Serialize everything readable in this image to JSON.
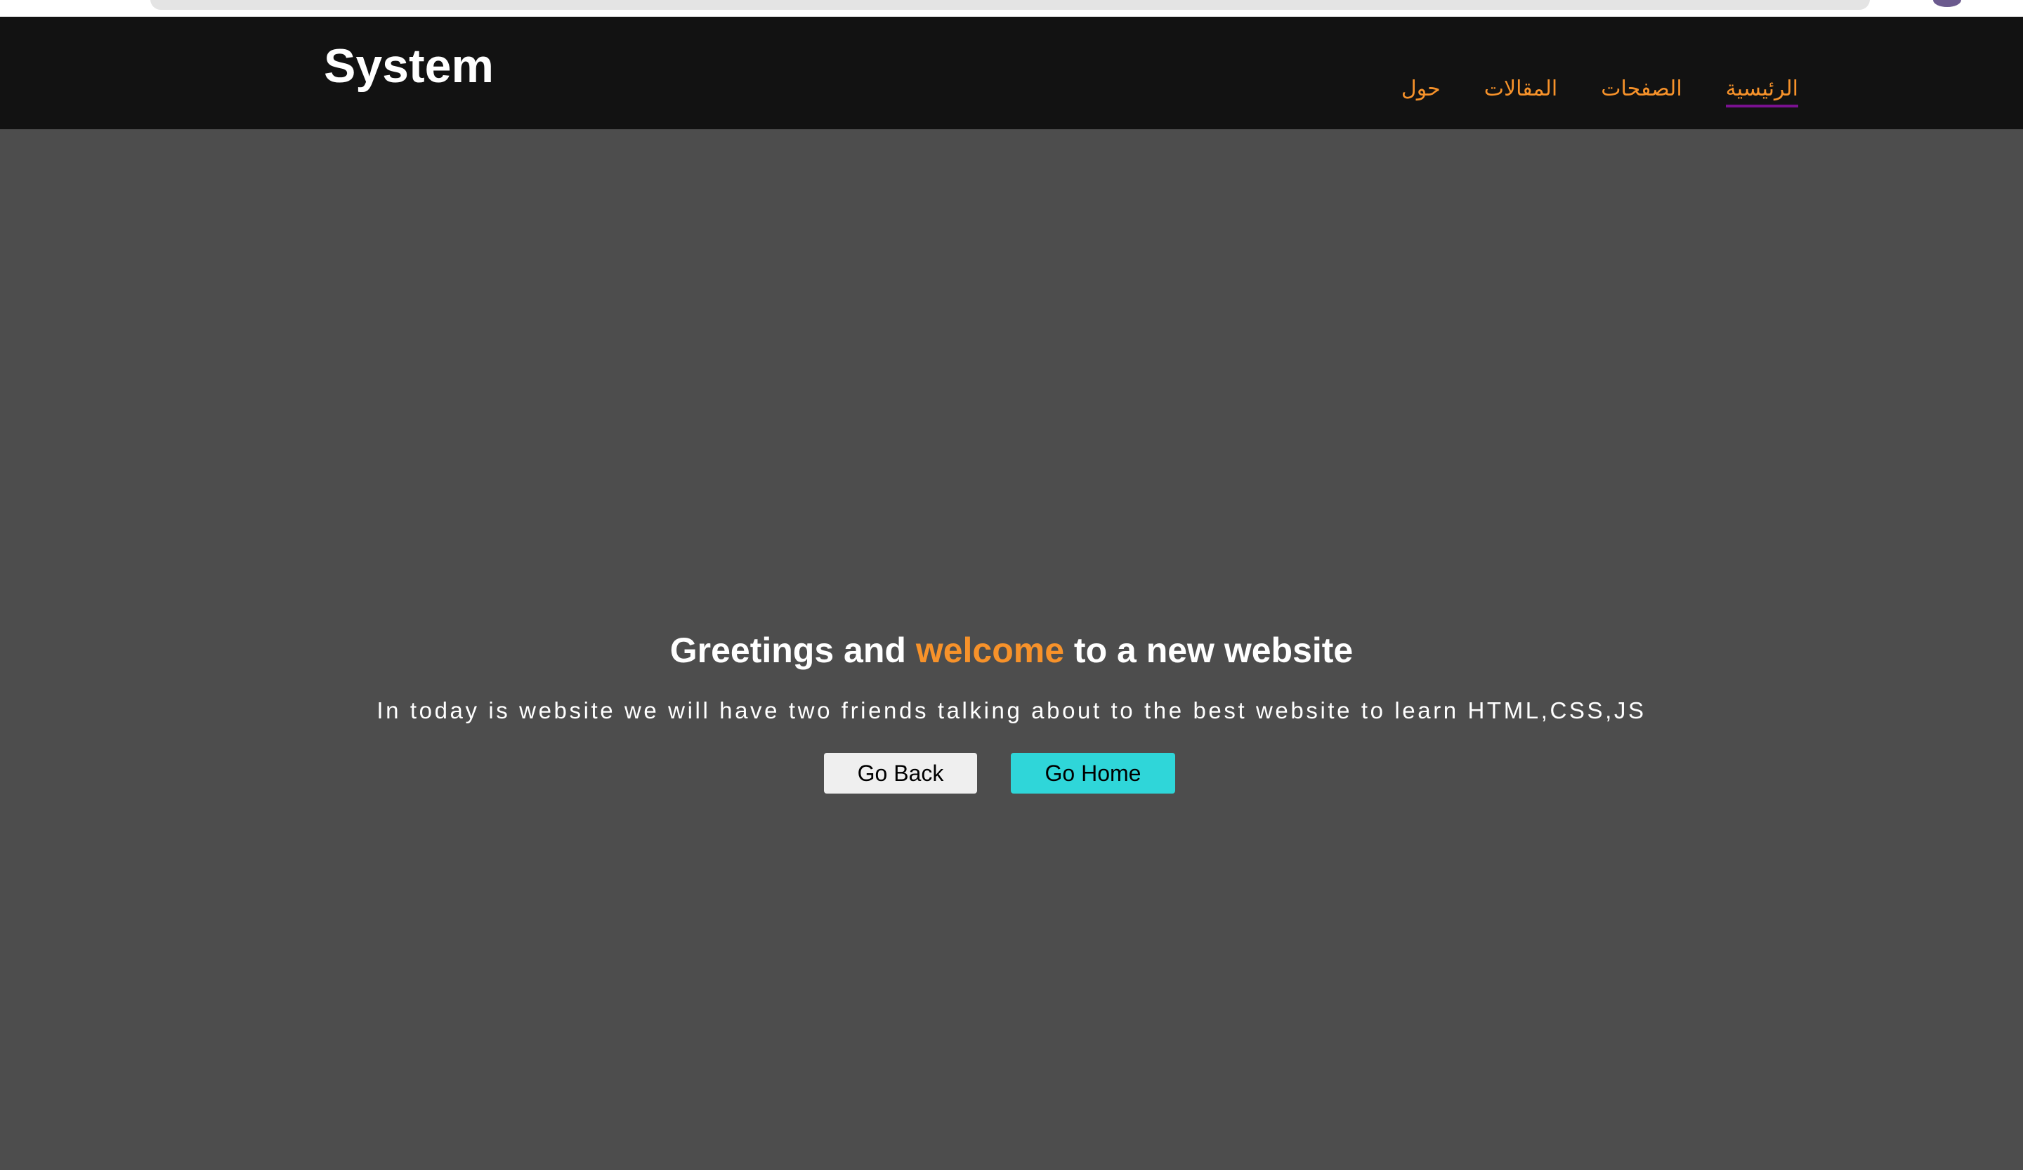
{
  "colors": {
    "header_bg": "#121212",
    "page_bg": "#4d4d4d",
    "accent_orange": "#f7922a",
    "nav_active_underline": "#7a1190",
    "home_button_bg": "#2fd6d9",
    "back_button_bg": "#efefef"
  },
  "header": {
    "brand": "System",
    "nav": [
      {
        "label": "الرئيسية",
        "active": true
      },
      {
        "label": "الصفحات",
        "active": false
      },
      {
        "label": "المقالات",
        "active": false
      },
      {
        "label": "حول",
        "active": false
      }
    ]
  },
  "hero": {
    "title_before": "Greetings and ",
    "title_accent": "welcome",
    "title_after": " to a new website",
    "subtitle": "In today is website we will have two friends talking about to the best website to learn HTML,CSS,JS",
    "buttons": {
      "back_label": "Go Back",
      "home_label": "Go Home"
    }
  }
}
